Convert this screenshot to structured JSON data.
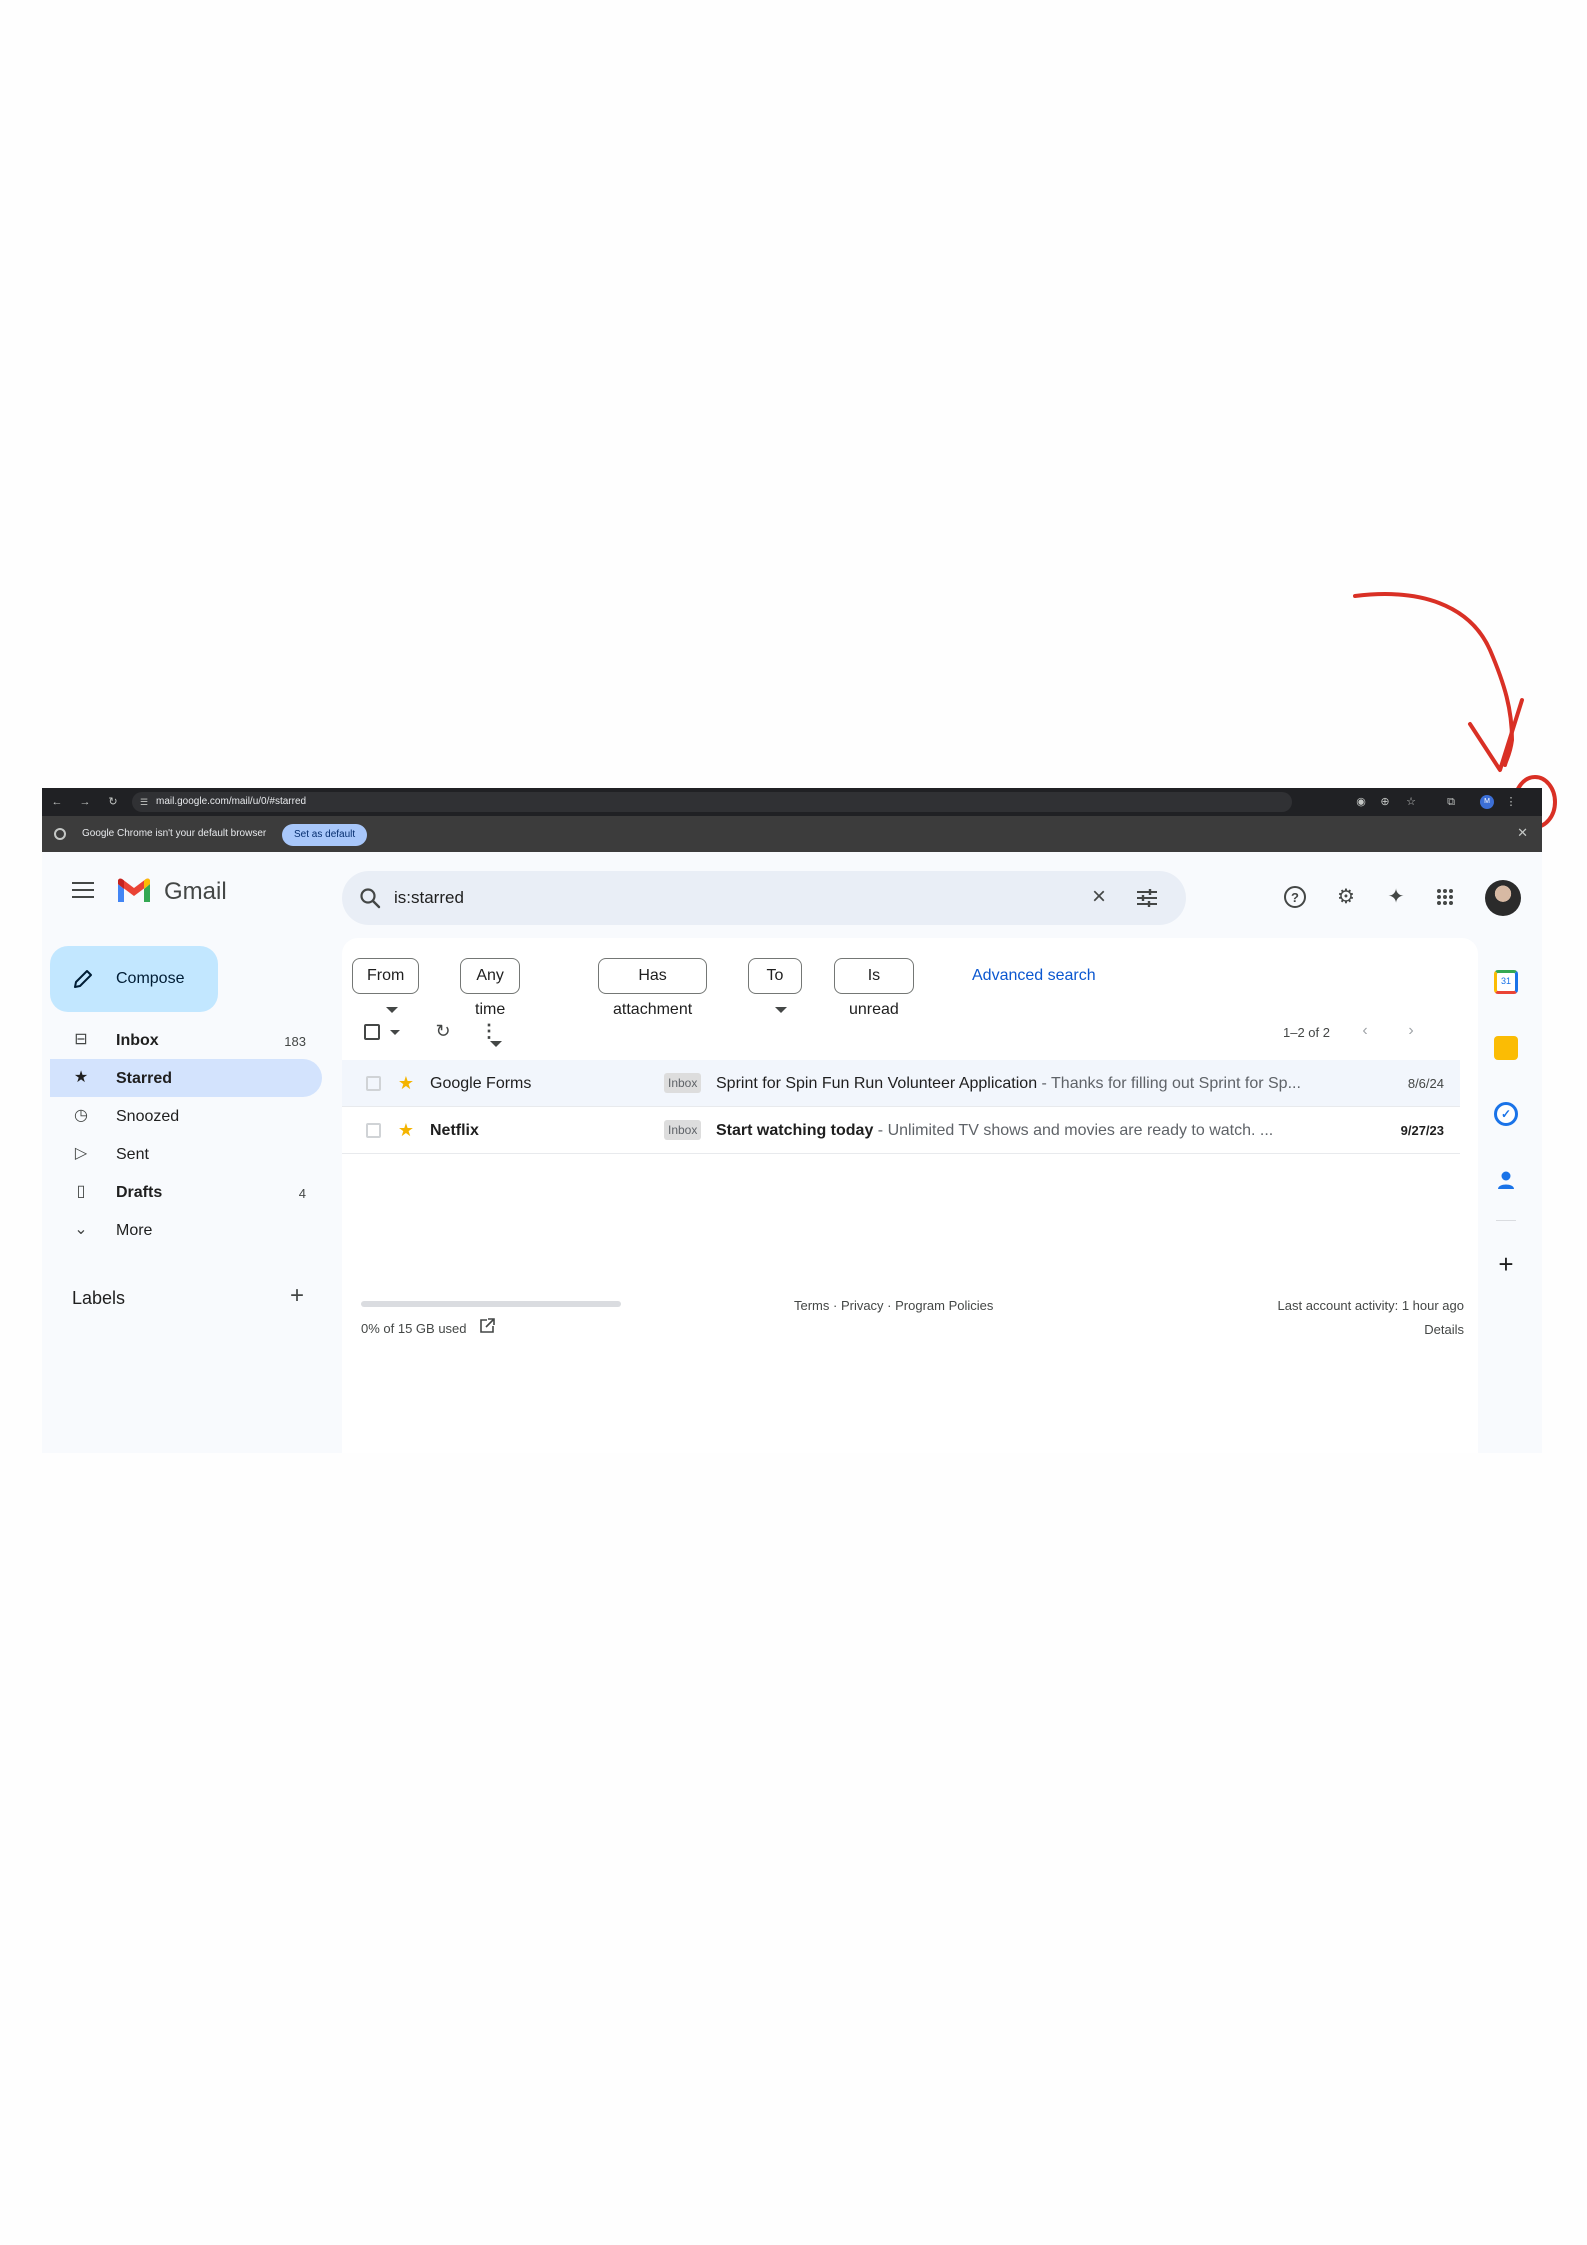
{
  "chrome": {
    "url": "mail.google.com/mail/u/0/#starred",
    "infobar_message": "Google Chrome isn't your default browser",
    "set_default_label": "Set as default",
    "profile_initial": "M"
  },
  "header": {
    "brand": "Gmail",
    "search_value": "is:starred"
  },
  "compose_label": "Compose",
  "sidebar": {
    "items": [
      {
        "label": "Inbox",
        "count": "183",
        "icon": "inbox-icon"
      },
      {
        "label": "Starred",
        "count": "",
        "icon": "star-icon"
      },
      {
        "label": "Snoozed",
        "count": "",
        "icon": "clock-icon"
      },
      {
        "label": "Sent",
        "count": "",
        "icon": "send-icon"
      },
      {
        "label": "Drafts",
        "count": "4",
        "icon": "draft-icon"
      },
      {
        "label": "More",
        "count": "",
        "icon": "chevron-down-icon"
      }
    ],
    "labels_heading": "Labels"
  },
  "filters": {
    "chips": [
      "From",
      "Any time",
      "Has attachment",
      "To",
      "Is unread"
    ],
    "advanced_search": "Advanced search"
  },
  "toolbar": {
    "count": "1–2 of 2"
  },
  "emails": [
    {
      "sender": "Google Forms",
      "label": "Inbox",
      "subject": "Sprint for Spin Fun Run Volunteer Application",
      "snippet": " - Thanks for filling out Sprint for Sp...",
      "date": "8/6/24",
      "starred": true,
      "unread": false
    },
    {
      "sender": "Netflix",
      "label": "Inbox",
      "subject": "Start watching today",
      "snippet": " - Unlimited TV shows and movies are ready to watch.      ...",
      "date": "9/27/23",
      "starred": true,
      "unread": true
    }
  ],
  "footer": {
    "storage": "0% of 15 GB used",
    "storage_used_fraction": 0,
    "links": "Terms · Privacy · Program Policies",
    "last_activity": "Last account activity: 1 hour ago",
    "details": "Details"
  },
  "colors": {
    "annotation": "#d93025",
    "accent": "#0b57d0",
    "compose_bg": "#c2e7ff",
    "active_nav": "#d3e3fd",
    "star": "#f4b400"
  }
}
